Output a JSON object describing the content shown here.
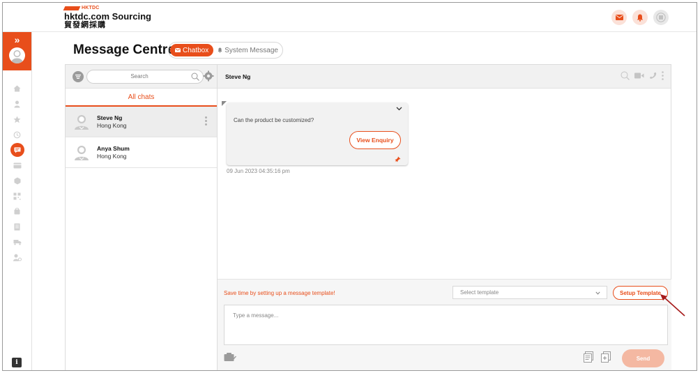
{
  "brand": {
    "mark_text": "HKTDC",
    "title": "hktdc.com Sourcing",
    "subtitle": "貿發網採購",
    "accent_color": "#e84e1b"
  },
  "header_icons": [
    "mail-icon",
    "bell-icon",
    "menu-icon"
  ],
  "sidebar": {
    "toggle_glyph": "»",
    "items": [
      "home-icon",
      "user-icon",
      "star-icon",
      "history-icon",
      "message-icon",
      "card-icon",
      "box-icon",
      "qr-icon",
      "bag-icon",
      "document-icon",
      "truck-icon",
      "user-settings-icon"
    ],
    "active_item": "message-icon",
    "info_glyph": "i"
  },
  "page": {
    "title": "Message Centre",
    "tabs": [
      {
        "label": "Chatbox",
        "active": true
      },
      {
        "label": "System Message",
        "active": false
      }
    ]
  },
  "chat_list": {
    "search_placeholder": "Search",
    "filter_label": "All chats",
    "chats": [
      {
        "name": "Steve Ng",
        "location": "Hong Kong",
        "selected": true
      },
      {
        "name": "Anya Shum",
        "location": "Hong Kong",
        "selected": false
      }
    ]
  },
  "conversation": {
    "contact_name": "Steve Ng",
    "message": {
      "text": "Can the product be customized?",
      "button_label": "View Enquiry",
      "timestamp": "09 Jun 2023 04:35:16 pm"
    }
  },
  "composer": {
    "template_hint": "Save time by setting up a message template!",
    "template_select_placeholder": "Select template",
    "setup_template_label": "Setup Template",
    "message_placeholder": "Type a message...",
    "send_label": "Send"
  }
}
